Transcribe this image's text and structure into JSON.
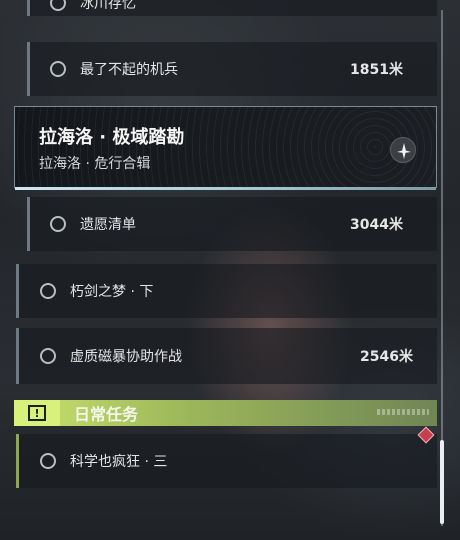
{
  "quests": {
    "top_partial": {
      "label": "冰川存忆"
    },
    "item1": {
      "label": "最了不起的机兵",
      "distance": "1851米"
    },
    "group": {
      "title": "拉海洛 · 极域踏勘",
      "subtitle": "拉海洛 · 危行合辑",
      "icon": "compass-icon"
    },
    "item2": {
      "label": "遗愿清单",
      "distance": "3044米"
    },
    "item3": {
      "label": "朽剑之梦 · 下"
    },
    "item4": {
      "label": "虚质磁暴协助作战",
      "distance": "2546米"
    }
  },
  "daily": {
    "title": "日常任务",
    "icon": "exclamation-icon",
    "item1": {
      "label": "科学也疯狂 · 三"
    }
  },
  "colors": {
    "accent_daily": "#c9e26e",
    "tracker_marker": "#c63f4c"
  }
}
